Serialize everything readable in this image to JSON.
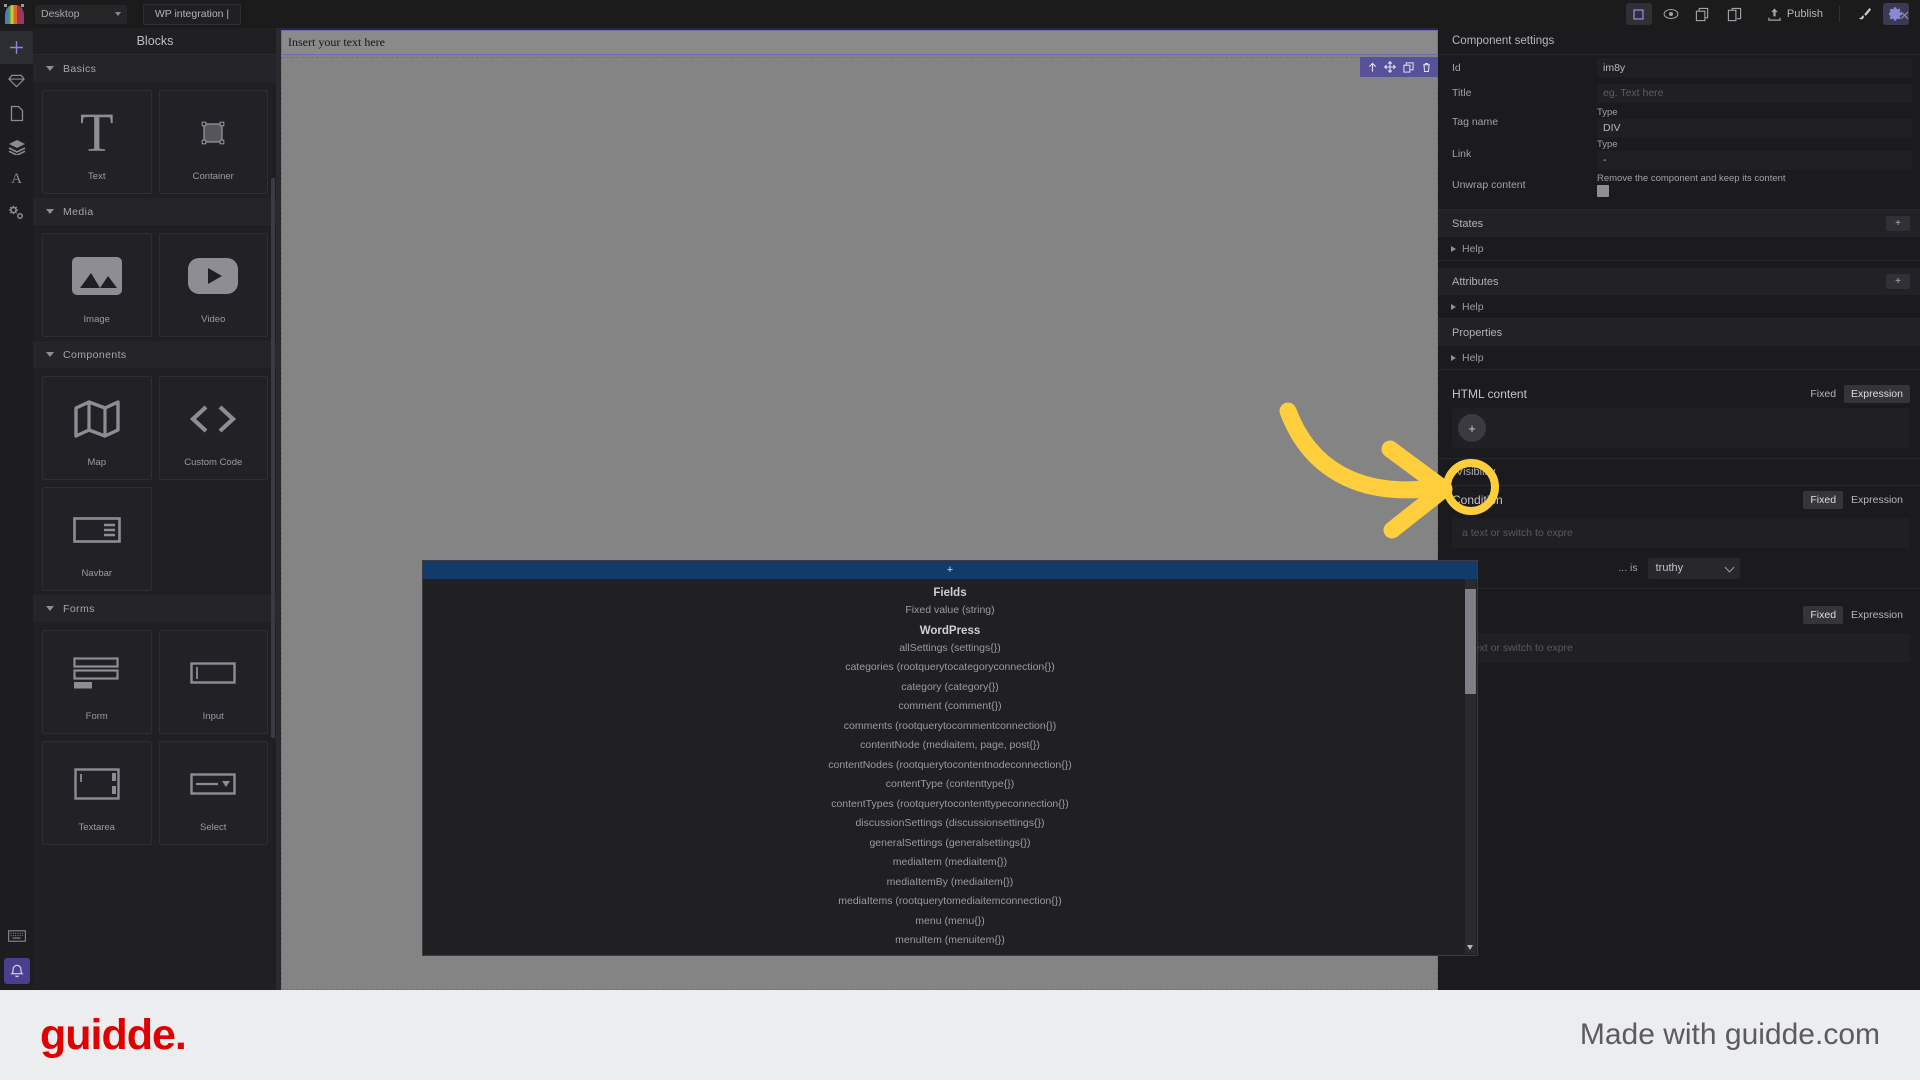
{
  "topbar": {
    "device_label": "Desktop",
    "tab_label": "WP integration |",
    "publish_label": "Publish",
    "icons": {
      "frame": "frame-icon",
      "preview": "eye-icon",
      "copy": "copy-icon",
      "paste": "paste-icon",
      "publish": "upload-icon",
      "brush": "brush-icon",
      "gear": "gear-icon",
      "close": "close-icon"
    }
  },
  "rail": {
    "items": [
      {
        "name": "add-icon",
        "glyph": "+"
      },
      {
        "name": "design-icon",
        "glyph": "diamond"
      },
      {
        "name": "pages-icon",
        "glyph": "page"
      },
      {
        "name": "layers-icon",
        "glyph": "layers"
      },
      {
        "name": "typography-icon",
        "glyph": "A"
      },
      {
        "name": "settings-icon",
        "glyph": "gears"
      }
    ],
    "bottom": [
      {
        "name": "keyboard-icon",
        "glyph": "keyboard"
      },
      {
        "name": "notifications-bell-icon",
        "glyph": "bell"
      }
    ]
  },
  "blocks": {
    "title": "Blocks",
    "groups": [
      {
        "label": "Basics",
        "items": [
          {
            "label": "Text",
            "icon": "text-t-icon"
          },
          {
            "label": "Container",
            "icon": "container-square-icon"
          }
        ]
      },
      {
        "label": "Media",
        "items": [
          {
            "label": "Image",
            "icon": "image-icon"
          },
          {
            "label": "Video",
            "icon": "video-play-icon"
          }
        ]
      },
      {
        "label": "Components",
        "items": [
          {
            "label": "Map",
            "icon": "map-icon"
          },
          {
            "label": "Custom Code",
            "icon": "code-brackets-icon"
          },
          {
            "label": "Navbar",
            "icon": "navbar-icon"
          }
        ]
      },
      {
        "label": "Forms",
        "items": [
          {
            "label": "Form",
            "icon": "form-icon"
          },
          {
            "label": "Input",
            "icon": "input-icon"
          },
          {
            "label": "Textarea",
            "icon": "textarea-icon"
          },
          {
            "label": "Select",
            "icon": "select-icon"
          }
        ]
      }
    ]
  },
  "canvas": {
    "text_block_value": "Insert your text here",
    "element_toolbar": [
      {
        "name": "move-up-icon",
        "glyph": "↑"
      },
      {
        "name": "drag-move-icon",
        "glyph": "✥"
      },
      {
        "name": "duplicate-icon",
        "glyph": "copy"
      },
      {
        "name": "delete-icon",
        "glyph": "trash"
      }
    ]
  },
  "settings": {
    "header": "Component settings",
    "fields": [
      {
        "label": "Id",
        "value": "im8y",
        "placeholder": "",
        "sublabel": ""
      },
      {
        "label": "Title",
        "value": "",
        "placeholder": "eg. Text here",
        "sublabel": ""
      },
      {
        "label": "Tag name",
        "value": "DIV",
        "placeholder": "",
        "sublabel": "Type"
      },
      {
        "label": "Link",
        "value": "-",
        "placeholder": "",
        "sublabel": "Type"
      },
      {
        "label": "Unwrap content",
        "value": "",
        "placeholder": "",
        "sublabel": "Remove the component and keep its content"
      }
    ],
    "sections": [
      {
        "title": "States",
        "add_label": "+",
        "help_label": "Help"
      },
      {
        "title": "Attributes",
        "add_label": "+",
        "help_label": "Help"
      },
      {
        "title": "Properties",
        "add_label": "",
        "help_label": "Help"
      }
    ],
    "html_content": {
      "label": "HTML content",
      "fixed_label": "Fixed",
      "expression_label": "Expression",
      "active_mode": "Expression",
      "add_button": "+"
    },
    "visibility": {
      "label": "Visibility"
    },
    "condition": {
      "label": "Condition",
      "fixed_label": "Fixed",
      "expression_label": "Expression",
      "active_mode": "Fixed",
      "input_placeholder": "a text or switch to expre",
      "is_label": "... is",
      "operator_value": "truthy"
    },
    "extra_field": {
      "fixed_label": "Fixed",
      "expression_label": "Expression",
      "active_mode": "Fixed",
      "input_placeholder": "a text or switch to expre"
    }
  },
  "autocomplete": {
    "groups": [
      {
        "title": "Fields",
        "items": [
          "Fixed value (string)"
        ]
      },
      {
        "title": "WordPress",
        "items": [
          "allSettings (settings{})",
          "categories (rootquerytocategoryconnection{})",
          "category (category{})",
          "comment (comment{})",
          "comments (rootquerytocommentconnection{})",
          "contentNode (mediaitem, page, post{})",
          "contentNodes (rootquerytocontentnodeconnection{})",
          "contentType (contenttype{})",
          "contentTypes (rootquerytocontenttypeconnection{})",
          "discussionSettings (discussionsettings{})",
          "generalSettings (generalsettings{})",
          "mediaItem (mediaitem{})",
          "mediaItemBy (mediaitem{})",
          "mediaItems (rootquerytomediaitemconnection{})",
          "menu (menu{})",
          "menuItem (menuitem{})"
        ]
      }
    ]
  },
  "annotation": {
    "highlight_color": "#ffce3d",
    "arrow_color": "#ffce3d"
  },
  "footer": {
    "brand": "guidde.",
    "made_with": "Made with guidde.com",
    "brand_color": "#e00000"
  }
}
